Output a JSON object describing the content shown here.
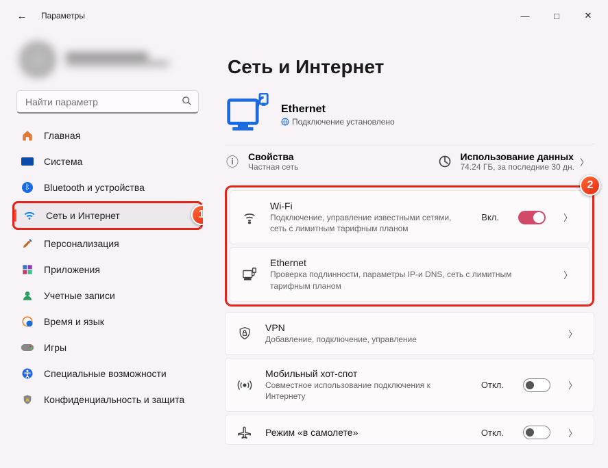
{
  "window": {
    "title": "Параметры"
  },
  "search": {
    "placeholder": "Найти параметр"
  },
  "sidebar": {
    "items": [
      {
        "label": "Главная"
      },
      {
        "label": "Система"
      },
      {
        "label": "Bluetooth и устройства"
      },
      {
        "label": "Сеть и Интернет"
      },
      {
        "label": "Персонализация"
      },
      {
        "label": "Приложения"
      },
      {
        "label": "Учетные записи"
      },
      {
        "label": "Время и язык"
      },
      {
        "label": "Игры"
      },
      {
        "label": "Специальные возможности"
      },
      {
        "label": "Конфиденциальность и защита"
      }
    ]
  },
  "page": {
    "title": "Сеть и Интернет",
    "status": {
      "name": "Ethernet",
      "sub": "Подключение установлено"
    },
    "info": {
      "props_title": "Свойства",
      "props_sub": "Частная сеть",
      "usage_title": "Использование данных",
      "usage_sub": "74.24 ГБ, за последние 30 дн."
    },
    "cards": {
      "wifi": {
        "title": "Wi-Fi",
        "sub": "Подключение, управление известными сетями, сеть с лимитным тарифным планом",
        "state": "Вкл."
      },
      "eth": {
        "title": "Ethernet",
        "sub": "Проверка подлинности, параметры IP-и DNS, сеть с лимитным тарифным планом"
      },
      "vpn": {
        "title": "VPN",
        "sub": "Добавление, подключение, управление"
      },
      "hotspot": {
        "title": "Мобильный хот-спот",
        "sub": "Совместное использование подключения к Интернету",
        "state": "Откл."
      },
      "airplane": {
        "title": "Режим «в самолете»",
        "state": "Откл."
      }
    }
  },
  "badges": {
    "one": "1",
    "two": "2"
  }
}
